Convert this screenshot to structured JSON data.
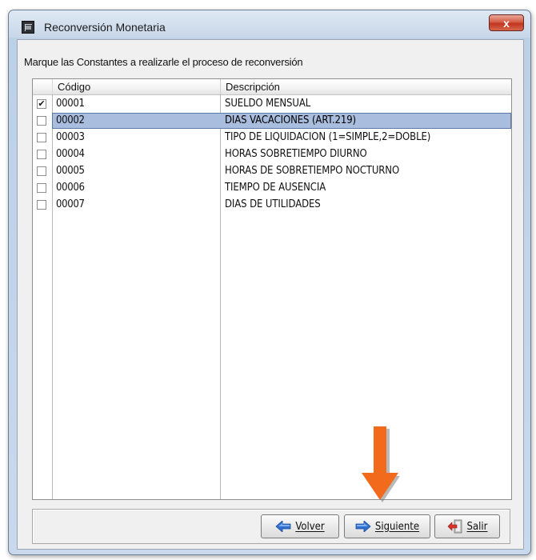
{
  "window": {
    "title": "Reconversión Monetaria",
    "close_label": "x"
  },
  "instruction": "Marque las Constantes  a realizarle el proceso de reconversión",
  "list": {
    "columns": [
      "Código",
      "Descripción"
    ],
    "rows": [
      {
        "checked": true,
        "code": "00001",
        "description": "SUELDO MENSUAL",
        "selected": false
      },
      {
        "checked": false,
        "code": "00002",
        "description": "DIAS VACACIONES (ART.219)",
        "selected": true
      },
      {
        "checked": false,
        "code": "00003",
        "description": "TIPO DE LIQUIDACION (1=SIMPLE,2=DOBLE)",
        "selected": false
      },
      {
        "checked": false,
        "code": "00004",
        "description": "HORAS SOBRETIEMPO DIURNO",
        "selected": false
      },
      {
        "checked": false,
        "code": "00005",
        "description": "HORAS DE SOBRETIEMPO NOCTURNO",
        "selected": false
      },
      {
        "checked": false,
        "code": "00006",
        "description": "TIEMPO DE AUSENCIA",
        "selected": false
      },
      {
        "checked": false,
        "code": "00007",
        "description": "DIAS DE UTILIDADES",
        "selected": false
      }
    ]
  },
  "buttons": {
    "volver": "Volver",
    "siguiente": "Siguiente",
    "salir": "Salir"
  },
  "icons": {
    "volver": "arrow-left-icon",
    "siguiente": "arrow-right-icon",
    "salir": "exit-icon",
    "annotation": "arrow-down-icon"
  },
  "colors": {
    "selection": "#a9bddf",
    "arrow_blue": "#2f6fd0",
    "annotation_orange": "#f26b1d"
  }
}
